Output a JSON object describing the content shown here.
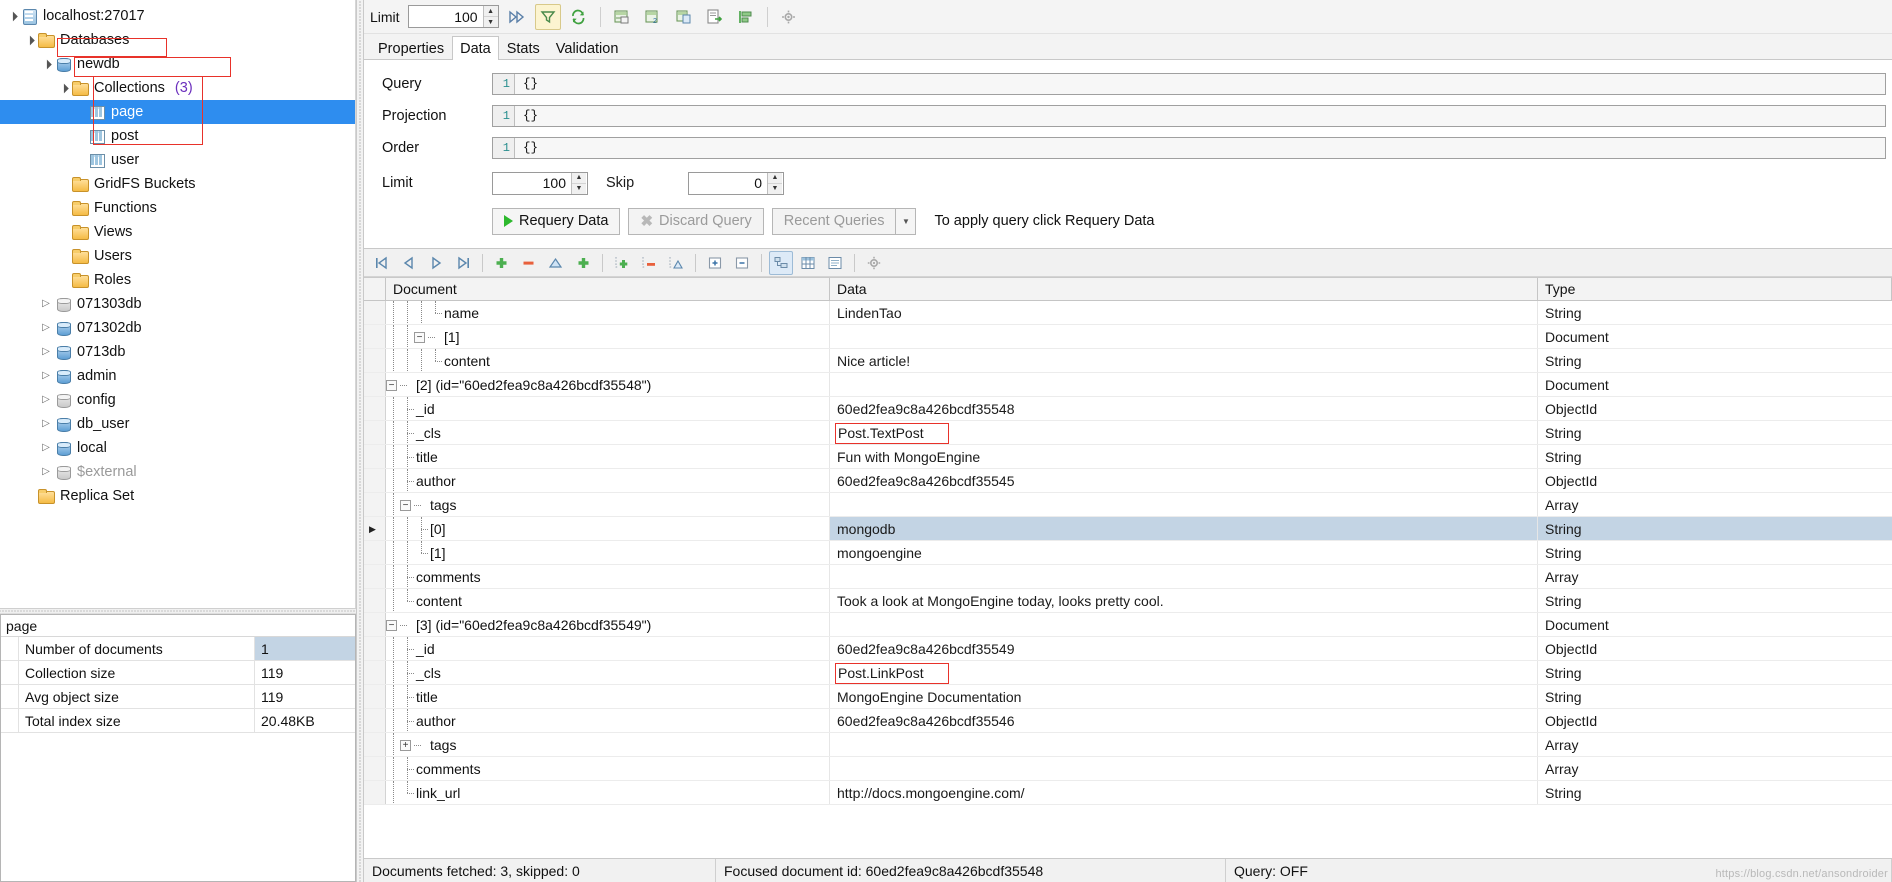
{
  "tree": {
    "nodes": [
      {
        "label": "localhost:27017",
        "icon": "server-icon",
        "indent": 0,
        "expander": "open",
        "kind": "server"
      },
      {
        "label": "Databases",
        "icon": "folder-icon",
        "indent": 1,
        "expander": "open",
        "kind": "folder"
      },
      {
        "label": "newdb",
        "icon": "database-icon",
        "indent": 2,
        "expander": "open",
        "kind": "db"
      },
      {
        "label": "Collections",
        "count": "(3)",
        "icon": "folder-icon",
        "indent": 3,
        "expander": "open",
        "kind": "folder"
      },
      {
        "label": "page",
        "icon": "collection-icon",
        "indent": 4,
        "expander": "none",
        "kind": "collection",
        "selected": true
      },
      {
        "label": "post",
        "icon": "collection-icon",
        "indent": 4,
        "expander": "none",
        "kind": "collection"
      },
      {
        "label": "user",
        "icon": "collection-icon",
        "indent": 4,
        "expander": "none",
        "kind": "collection"
      },
      {
        "label": "GridFS Buckets",
        "icon": "folder-icon",
        "indent": 3,
        "expander": "none",
        "kind": "folder"
      },
      {
        "label": "Functions",
        "icon": "folder-icon",
        "indent": 3,
        "expander": "none",
        "kind": "folder"
      },
      {
        "label": "Views",
        "icon": "folder-icon",
        "indent": 3,
        "expander": "none",
        "kind": "folder"
      },
      {
        "label": "Users",
        "icon": "folder-icon",
        "indent": 3,
        "expander": "none",
        "kind": "folder"
      },
      {
        "label": "Roles",
        "icon": "folder-icon",
        "indent": 3,
        "expander": "none",
        "kind": "folder"
      },
      {
        "label": "071303db",
        "icon": "database-icon",
        "indent": 2,
        "expander": "closed",
        "kind": "db",
        "dim": true
      },
      {
        "label": "071302db",
        "icon": "database-icon",
        "indent": 2,
        "expander": "closed",
        "kind": "db"
      },
      {
        "label": "0713db",
        "icon": "database-icon",
        "indent": 2,
        "expander": "closed",
        "kind": "db"
      },
      {
        "label": "admin",
        "icon": "database-icon",
        "indent": 2,
        "expander": "closed",
        "kind": "db"
      },
      {
        "label": "config",
        "icon": "database-icon",
        "indent": 2,
        "expander": "closed",
        "kind": "db",
        "dim": true
      },
      {
        "label": "db_user",
        "icon": "database-icon",
        "indent": 2,
        "expander": "closed",
        "kind": "db"
      },
      {
        "label": "local",
        "icon": "database-icon",
        "indent": 2,
        "expander": "closed",
        "kind": "db"
      },
      {
        "label": "$external",
        "icon": "database-icon",
        "indent": 2,
        "expander": "closed",
        "kind": "db",
        "dim": true,
        "muted": true
      },
      {
        "label": "Replica Set",
        "icon": "folder-icon",
        "indent": 1,
        "expander": "none",
        "kind": "folder"
      }
    ]
  },
  "properties": {
    "title": "page",
    "rows": [
      {
        "key": "Number of documents",
        "value": "1"
      },
      {
        "key": "Collection size",
        "value": "119"
      },
      {
        "key": "Avg object size",
        "value": "119"
      },
      {
        "key": "Total index size",
        "value": "20.48KB"
      }
    ]
  },
  "toolbar": {
    "limit_label": "Limit",
    "limit_value": "100",
    "buttons": [
      {
        "name": "run-fast-forward-icon",
        "glyph": "»"
      },
      {
        "name": "filter-funnel-icon",
        "glyph": "▽"
      },
      {
        "name": "refresh-icon",
        "glyph": "↻"
      },
      {
        "name": "export-table-icon",
        "glyph": "▤"
      },
      {
        "name": "duplicate-table-icon",
        "glyph": "▤"
      },
      {
        "name": "copy-collection-icon",
        "glyph": "▤"
      },
      {
        "name": "export-document-icon",
        "glyph": "⎙"
      },
      {
        "name": "align-icon",
        "glyph": "≡"
      },
      {
        "name": "settings-gear-icon",
        "glyph": "⚙"
      }
    ]
  },
  "tabs": [
    {
      "label": "Properties",
      "selected": false
    },
    {
      "label": "Data",
      "selected": true
    },
    {
      "label": "Stats",
      "selected": false
    },
    {
      "label": "Validation",
      "selected": false
    }
  ],
  "query_form": {
    "query_label": "Query",
    "query_line_no": "1",
    "query_value": "{}",
    "projection_label": "Projection",
    "projection_line_no": "1",
    "projection_value": "{}",
    "order_label": "Order",
    "order_line_no": "1",
    "order_value": "{}",
    "limit_label": "Limit",
    "limit_value": "100",
    "skip_label": "Skip",
    "skip_value": "0",
    "requery_button": "Requery Data",
    "discard_button": "Discard Query",
    "recent_button": "Recent Queries",
    "hint": "To apply query click Requery Data"
  },
  "grid_toolbar": {
    "buttons": [
      {
        "name": "first-record-icon",
        "glyph": "⏮"
      },
      {
        "name": "previous-record-icon",
        "glyph": "◁"
      },
      {
        "name": "next-record-icon",
        "glyph": "▷"
      },
      {
        "name": "last-record-icon",
        "glyph": "⏭"
      },
      {
        "name": "add-document-icon",
        "glyph": "✚"
      },
      {
        "name": "delete-document-icon",
        "glyph": "➖"
      },
      {
        "name": "edit-document-icon",
        "glyph": "△"
      },
      {
        "name": "add-field-icon",
        "glyph": "✚"
      },
      {
        "name": "add-subfield-icon",
        "glyph": "✚"
      },
      {
        "name": "remove-subfield-icon",
        "glyph": "➖"
      },
      {
        "name": "edit-subfield-icon",
        "glyph": "△"
      },
      {
        "name": "expand-all-icon",
        "glyph": "＋"
      },
      {
        "name": "collapse-all-icon",
        "glyph": "－"
      },
      {
        "name": "tree-view-icon",
        "glyph": "▤"
      },
      {
        "name": "table-view-icon",
        "glyph": "▦"
      },
      {
        "name": "text-view-icon",
        "glyph": "▤"
      },
      {
        "name": "grid-settings-gear-icon",
        "glyph": "⚙"
      }
    ]
  },
  "grid": {
    "headers": [
      "Document",
      "Data",
      "Type"
    ],
    "rows": [
      {
        "depth": 4,
        "connector": "ell",
        "toggle": "none",
        "label": "name",
        "data": "LindenTao",
        "type": "String"
      },
      {
        "depth": 3,
        "connector": "tee",
        "toggle": "minus",
        "label": "[1]",
        "data": "",
        "type": "Document"
      },
      {
        "depth": 4,
        "connector": "ell",
        "toggle": "none",
        "label": "content",
        "data": "Nice article!",
        "type": "String"
      },
      {
        "depth": 1,
        "connector": "tee",
        "toggle": "minus",
        "label": "[2] (id=\"60ed2fea9c8a426bcdf35548\")",
        "data": "",
        "type": "Document"
      },
      {
        "depth": 2,
        "connector": "tee",
        "toggle": "none",
        "label": "_id",
        "data": "60ed2fea9c8a426bcdf35548",
        "type": "ObjectId"
      },
      {
        "depth": 2,
        "connector": "tee",
        "toggle": "none",
        "label": "_cls",
        "data": "Post.TextPost",
        "type": "String",
        "highlight_box": true
      },
      {
        "depth": 2,
        "connector": "tee",
        "toggle": "none",
        "label": "title",
        "data": "Fun with MongoEngine",
        "type": "String"
      },
      {
        "depth": 2,
        "connector": "tee",
        "toggle": "none",
        "label": "author",
        "data": "60ed2fea9c8a426bcdf35545",
        "type": "ObjectId"
      },
      {
        "depth": 2,
        "connector": "tee",
        "toggle": "minus",
        "label": "tags",
        "data": "",
        "type": "Array"
      },
      {
        "depth": 3,
        "connector": "tee",
        "toggle": "none",
        "label": "[0]",
        "data": "mongodb",
        "type": "String",
        "selected": true,
        "cursor": true
      },
      {
        "depth": 3,
        "connector": "ell",
        "toggle": "none",
        "label": "[1]",
        "data": "mongoengine",
        "type": "String"
      },
      {
        "depth": 2,
        "connector": "tee",
        "toggle": "none",
        "label": "comments",
        "data": "",
        "type": "Array"
      },
      {
        "depth": 2,
        "connector": "ell",
        "toggle": "none",
        "label": "content",
        "data": "Took a look at MongoEngine today, looks pretty cool.",
        "type": "String"
      },
      {
        "depth": 1,
        "connector": "tee",
        "toggle": "minus",
        "label": "[3] (id=\"60ed2fea9c8a426bcdf35549\")",
        "data": "",
        "type": "Document"
      },
      {
        "depth": 2,
        "connector": "tee",
        "toggle": "none",
        "label": "_id",
        "data": "60ed2fea9c8a426bcdf35549",
        "type": "ObjectId"
      },
      {
        "depth": 2,
        "connector": "tee",
        "toggle": "none",
        "label": "_cls",
        "data": "Post.LinkPost",
        "type": "String",
        "highlight_box": true
      },
      {
        "depth": 2,
        "connector": "tee",
        "toggle": "none",
        "label": "title",
        "data": "MongoEngine Documentation",
        "type": "String"
      },
      {
        "depth": 2,
        "connector": "tee",
        "toggle": "none",
        "label": "author",
        "data": "60ed2fea9c8a426bcdf35546",
        "type": "ObjectId"
      },
      {
        "depth": 2,
        "connector": "tee",
        "toggle": "plus",
        "label": "tags",
        "data": "",
        "type": "Array"
      },
      {
        "depth": 2,
        "connector": "tee",
        "toggle": "none",
        "label": "comments",
        "data": "",
        "type": "Array"
      },
      {
        "depth": 2,
        "connector": "ell",
        "toggle": "none",
        "label": "link_url",
        "data": "http://docs.mongoengine.com/",
        "type": "String"
      }
    ]
  },
  "status": {
    "fetched": "Documents fetched: 3, skipped: 0",
    "focused": "Focused document id: 60ed2fea9c8a426bcdf35548",
    "query": "Query: OFF"
  },
  "watermark": "https://blog.csdn.net/ansondroider",
  "colors": {
    "selection_blue": "#2f8ced",
    "annotation_red": "#e8322a",
    "grid_selection": "#c3d4e4",
    "count_purple": "#6b2fbd"
  }
}
